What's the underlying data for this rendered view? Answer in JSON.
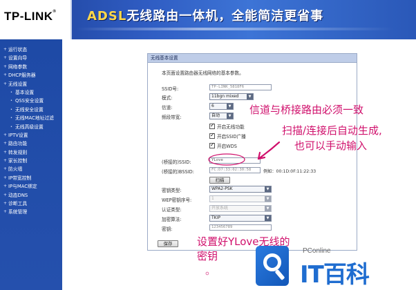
{
  "header": {
    "logo": "TP-LINK",
    "logo_mark": "®",
    "banner_prefix": "ADSL",
    "banner_text": "无线路由一体机，全能简洁更省事"
  },
  "sidebar": {
    "items": [
      {
        "label": "运行状态",
        "sub": false
      },
      {
        "label": "设置向导",
        "sub": false
      },
      {
        "label": "网络参数",
        "sub": false
      },
      {
        "label": "DHCP服务器",
        "sub": false
      },
      {
        "label": "无线设置",
        "sub": false
      },
      {
        "label": "基本设置",
        "sub": true
      },
      {
        "label": "QSS安全设置",
        "sub": true
      },
      {
        "label": "无线安全设置",
        "sub": true
      },
      {
        "label": "无线MAC地址过滤",
        "sub": true
      },
      {
        "label": "无线高级设置",
        "sub": true
      },
      {
        "label": "IPTV设置",
        "sub": false
      },
      {
        "label": "路由功能",
        "sub": false
      },
      {
        "label": "转发规则",
        "sub": false
      },
      {
        "label": "家长控制",
        "sub": false
      },
      {
        "label": "防火墙",
        "sub": false
      },
      {
        "label": "IP带宽控制",
        "sub": false
      },
      {
        "label": "IP与MAC绑定",
        "sub": false
      },
      {
        "label": "动态DNS",
        "sub": false
      },
      {
        "label": "诊断工具",
        "sub": false
      },
      {
        "label": "系统管理",
        "sub": false
      }
    ]
  },
  "panel": {
    "title": "无线基本设置",
    "description": "本页面设置路由器无线网络的基本参数。",
    "ssid_label": "SSID号:",
    "ssid_value": "TP-LINK_5818F6",
    "mode_label": "模式:",
    "mode_value": "11bgn mixed",
    "channel_label": "信道:",
    "channel_value": "6",
    "bandwidth_label": "频段带宽:",
    "bandwidth_value": "自动",
    "enable_wireless": "开启无线功能",
    "enable_ssid_broadcast": "开启SSID广播",
    "enable_wds": "开启WDS",
    "bridge_ssid_label": "(桥接的)SSID:",
    "bridge_ssid_value": "YLove",
    "bridge_bssid_label": "(桥接的)BSSID:",
    "bridge_bssid_value": "FC:D7:33:02:30:58",
    "example_text": "例如：00:1D:0F:11:22:33",
    "scan_button": "扫描",
    "key_type_label": "密钥类型:",
    "key_type_value": "WPA2-PSK",
    "wep_index_label": "WEP密钥序号:",
    "wep_index_value": "1",
    "auth_type_label": "认证类型:",
    "auth_type_value": "开放系统",
    "encryption_label": "加密算法:",
    "encryption_value": "TKIP",
    "password_label": "密钥:",
    "password_value": "123456789",
    "save_button": "保存"
  },
  "annotations": {
    "line1": "信道与桥接路由必须一致",
    "line2": "扫描/连接后自动生成,",
    "line3": "也可以手动输入",
    "line4": "设置好YLove无线的",
    "line5": "密钥",
    "line6": "。"
  },
  "watermark": {
    "site": "PConline",
    "brand": "IT百科"
  },
  "colors": {
    "sidebar_bg": "#2550ad",
    "header_bg": "#2f5cc2",
    "annotation": "#d0106c",
    "watermark_blue": "#1f6dd0"
  }
}
